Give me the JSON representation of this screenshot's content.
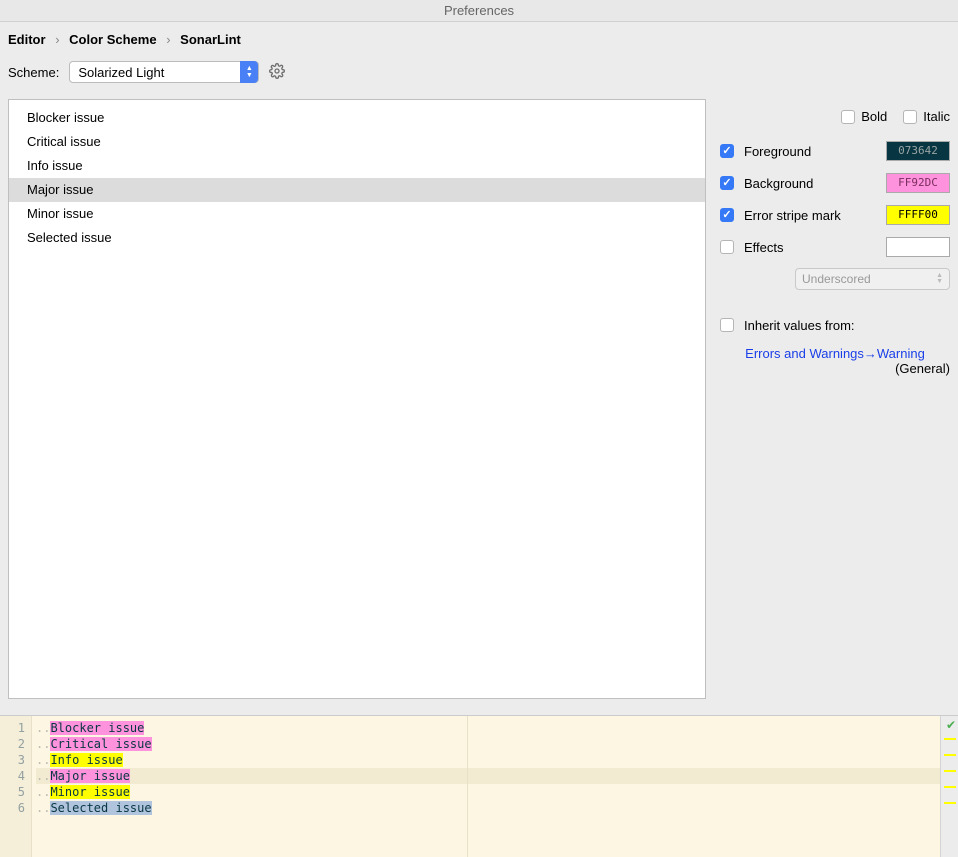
{
  "window": {
    "title": "Preferences"
  },
  "breadcrumb": {
    "a": "Editor",
    "b": "Color Scheme",
    "c": "SonarLint"
  },
  "scheme": {
    "label": "Scheme:",
    "value": "Solarized Light"
  },
  "issues": {
    "items": [
      "Blocker issue",
      "Critical issue",
      "Info issue",
      "Major issue",
      "Minor issue",
      "Selected issue"
    ],
    "selected_index": 3
  },
  "font_style": {
    "bold": "Bold",
    "italic": "Italic",
    "bold_checked": false,
    "italic_checked": false
  },
  "attrs": {
    "foreground": {
      "label": "Foreground",
      "checked": true,
      "hex": "073642",
      "swatch_bg": "#073642",
      "swatch_fg": "#9aa4a3"
    },
    "background": {
      "label": "Background",
      "checked": true,
      "hex": "FF92DC",
      "swatch_bg": "#ff92dc",
      "swatch_fg": "#7a2d5e"
    },
    "stripe": {
      "label": "Error stripe mark",
      "checked": true,
      "hex": "FFFF00",
      "swatch_bg": "#ffff00",
      "swatch_fg": "#000"
    },
    "effects": {
      "label": "Effects",
      "checked": false,
      "type": "Underscored"
    }
  },
  "inherit": {
    "label": "Inherit values from:",
    "checked": false,
    "link": "Errors and Warnings→Warning",
    "sub": "(General)"
  },
  "preview": {
    "lines": [
      {
        "n": "1",
        "dots": "..",
        "seg": "Blocker issue",
        "cls": "hl-pink"
      },
      {
        "n": "2",
        "dots": "..",
        "seg": "Critical issue",
        "cls": "hl-pink"
      },
      {
        "n": "3",
        "dots": "..",
        "seg": "Info issue",
        "cls": "hl-yellow"
      },
      {
        "n": "4",
        "dots": "..",
        "seg": "Major issue",
        "cls": "hl-pink",
        "row_hl": true
      },
      {
        "n": "5",
        "dots": "..",
        "seg": "Minor issue",
        "cls": "hl-yellow"
      },
      {
        "n": "6",
        "dots": "..",
        "seg": "Selected issue",
        "cls": "hl-sel"
      }
    ]
  }
}
